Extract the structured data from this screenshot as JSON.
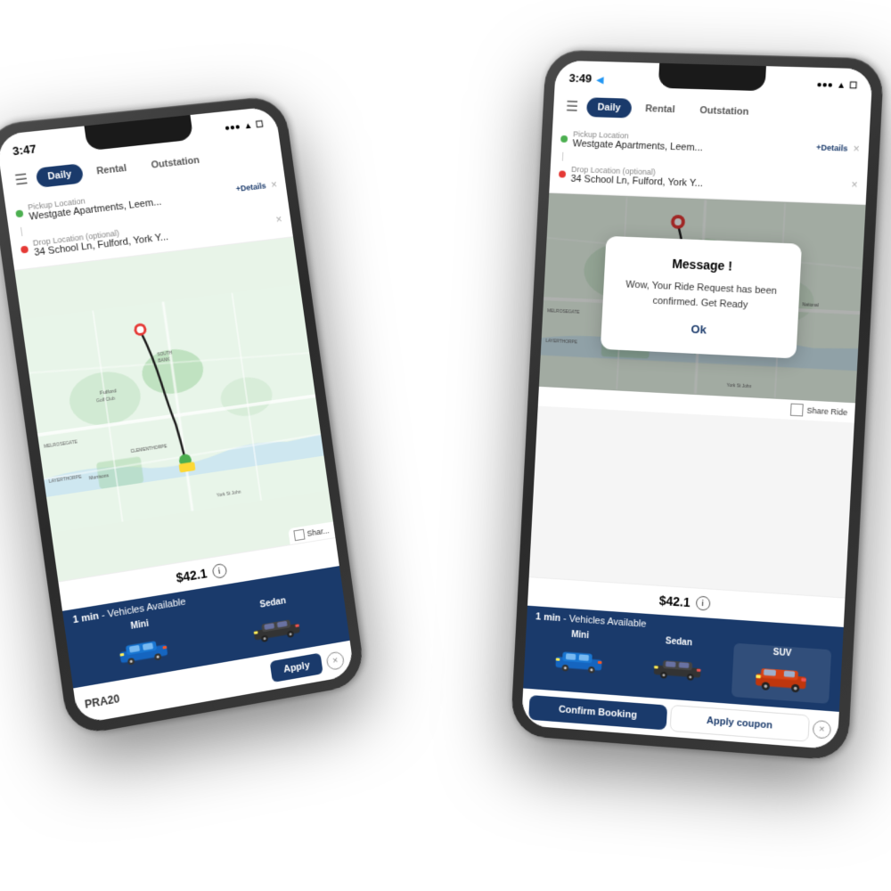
{
  "scene": {
    "background": "#ffffff"
  },
  "phone_left": {
    "status": {
      "time": "3:47",
      "icons": "●●● ▲ ☐"
    },
    "tabs": [
      "Daily",
      "Rental",
      "Outstation"
    ],
    "active_tab": "Daily",
    "pickup": {
      "label": "Pickup Location",
      "value": "Westgate Apartments, Leem...",
      "details_link": "+Details"
    },
    "dropoff": {
      "label": "Drop Location (optional)",
      "value": "34 School Ln, Fulford, York Y..."
    },
    "price": "$42.1",
    "vehicles_header": "1 min",
    "vehicles_subheader": " - Vehicles Available",
    "vehicles": [
      {
        "name": "Mini",
        "color": "blue"
      },
      {
        "name": "Sedan",
        "color": "dark"
      }
    ],
    "coupon": {
      "value": "PRA20",
      "apply_label": "Apply"
    }
  },
  "phone_right": {
    "status": {
      "time": "3:49",
      "icons": "●●● ▲ ☐"
    },
    "tabs": [
      "Daily",
      "Rental",
      "Outstation"
    ],
    "active_tab": "Daily",
    "pickup": {
      "label": "Pickup Location",
      "value": "Westgate Apartments, Leem...",
      "details_link": "+Details"
    },
    "dropoff": {
      "label": "Drop Location (optional)",
      "value": "34 School Ln, Fulford, York Y..."
    },
    "price": "$42.1",
    "share_ride_label": "Share Ride",
    "vehicles_header": "1 min",
    "vehicles_subheader": " - Vehicles Available",
    "vehicles": [
      {
        "name": "Mini",
        "color": "blue"
      },
      {
        "name": "Sedan",
        "color": "dark"
      },
      {
        "name": "SUV",
        "color": "orange"
      }
    ],
    "bottom_bar": {
      "confirm_label": "Confirm Booking",
      "coupon_label": "Apply coupon"
    },
    "dialog": {
      "title": "Message !",
      "body": "Wow, Your Ride Request has been confirmed. Get Ready",
      "ok_label": "Ok"
    }
  }
}
